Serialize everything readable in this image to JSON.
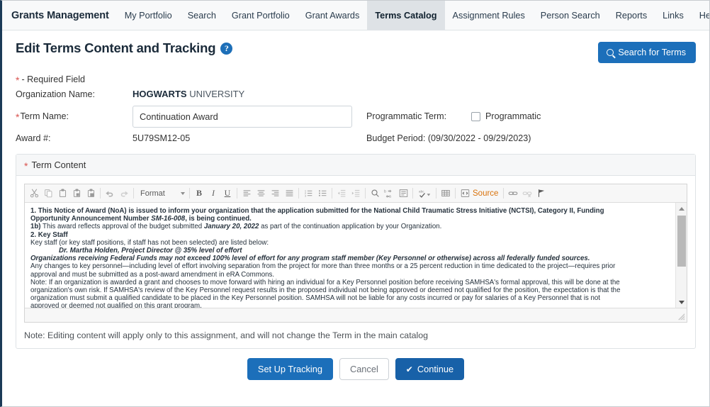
{
  "nav": {
    "brand": "Grants Management",
    "items": [
      {
        "label": "My Portfolio",
        "active": false
      },
      {
        "label": "Search",
        "active": false
      },
      {
        "label": "Grant Portfolio",
        "active": false
      },
      {
        "label": "Grant Awards",
        "active": false
      },
      {
        "label": "Terms Catalog",
        "active": true
      },
      {
        "label": "Assignment Rules",
        "active": false
      },
      {
        "label": "Person Search",
        "active": false
      },
      {
        "label": "Reports",
        "active": false
      },
      {
        "label": "Links",
        "active": false
      },
      {
        "label": "Help",
        "active": false
      }
    ]
  },
  "header": {
    "title": "Edit Terms Content and Tracking",
    "help_icon": "question-mark-icon",
    "search_button": "Search for Terms",
    "search_icon": "search-icon",
    "accent_color": "#1c6fba"
  },
  "form": {
    "required_note": "- Required Field",
    "required_star": "*",
    "organization_label": "Organization Name:",
    "organization_value_strong": "HOGWARTS",
    "organization_value_light": "UNIVERSITY",
    "term_name_label": "Term Name:",
    "term_name_value": "Continuation Award",
    "term_name_placeholder": "Continuation Award",
    "award_label": "Award #:",
    "award_value": "5U79SM12-05",
    "programmatic_term_label": "Programmatic Term:",
    "programmatic_checkbox_label": "Programmatic",
    "programmatic_checked": false,
    "budget_period": "Budget Period: (09/30/2022 - 09/29/2023)"
  },
  "term_content": {
    "panel_title": "Term Content",
    "panel_star": "*",
    "toolbar": {
      "format_label": "Format",
      "source_label": "Source",
      "buttons": [
        "cut-icon",
        "copy-icon",
        "paste-icon",
        "paste-text-icon",
        "paste-word-icon",
        "undo-icon",
        "redo-icon",
        "bold-icon",
        "italic-icon",
        "underline-icon",
        "align-left-icon",
        "align-center-icon",
        "align-right-icon",
        "justify-icon",
        "numbered-list-icon",
        "bulleted-list-icon",
        "outdent-icon",
        "indent-icon",
        "find-icon",
        "replace-icon",
        "show-blocks-icon",
        "spellcheck-icon",
        "table-icon",
        "source-icon",
        "link-icon",
        "unlink-icon",
        "anchor-icon"
      ]
    },
    "lines": [
      {
        "segments": [
          {
            "text": "1. This Notice of Award (NoA) is issued to inform your organization that the application submitted for the National Child Traumatic Stress Initiative (NCTSI), Category II, Funding",
            "style": "b"
          }
        ]
      },
      {
        "segments": [
          {
            "text": "Opportunity Announcement Number ",
            "style": "b"
          },
          {
            "text": "SM-16-008",
            "style": "bi"
          },
          {
            "text": ", is being continued.",
            "style": "b"
          }
        ]
      },
      {
        "segments": [
          {
            "text": "1b)",
            "style": "b"
          },
          {
            "text": " This award reflects approval of the budget submitted ",
            "style": ""
          },
          {
            "text": "January 20, 2022",
            "style": "bi"
          },
          {
            "text": " as part of the continuation application by your Organization.",
            "style": ""
          }
        ]
      },
      {
        "segments": [
          {
            "text": "2. Key Staff",
            "style": "b"
          }
        ]
      },
      {
        "segments": [
          {
            "text": "Key staff (or key staff positions, if staff has not been selected) are listed below:",
            "style": ""
          }
        ]
      },
      {
        "indent": true,
        "segments": [
          {
            "text": "Dr. Martha Holden, Project Director @ 35% level of effort",
            "style": "bi"
          }
        ]
      },
      {
        "segments": [
          {
            "text": "Organizations receiving Federal Funds may not exceed 100% level of effort for any program staff member (Key Personnel or otherwise) across all federally funded sources.",
            "style": "bi"
          }
        ]
      },
      {
        "segments": [
          {
            "text": "Any changes to key personnel—including level of effort involving separation from the project for more than three months or a 25 percent reduction in time dedicated to the project—requires prior",
            "style": ""
          }
        ]
      },
      {
        "segments": [
          {
            "text": "approval and must be submitted as a post-award amendment in eRA Commons.",
            "style": ""
          }
        ]
      },
      {
        "segments": [
          {
            "text": "Note: If an organization is awarded a grant and chooses to move forward with hiring an individual for a Key Personnel position before receiving SAMHSA's formal approval, this will be done at the",
            "style": ""
          }
        ]
      },
      {
        "segments": [
          {
            "text": "organization's own risk. If SAMHSA's review of the Key Personnel request results in the proposed individual not being approved or deemed not qualified for the position, the expectation is that the",
            "style": ""
          }
        ]
      },
      {
        "segments": [
          {
            "text": "organization must submit a qualified candidate to be placed in the Key Personnel position. SAMHSA will not be liable for any costs incurred or pay for salaries of a Key Personnel that is not",
            "style": ""
          }
        ]
      },
      {
        "segments": [
          {
            "text": "approved or deemed not qualified on this grant program.",
            "style": ""
          }
        ]
      }
    ],
    "note": "Note: Editing content will apply only to this assignment, and will not change the Term in the main catalog"
  },
  "footer": {
    "setup_tracking": "Set Up Tracking",
    "cancel": "Cancel",
    "continue": "Continue",
    "continue_icon": "check-icon"
  }
}
